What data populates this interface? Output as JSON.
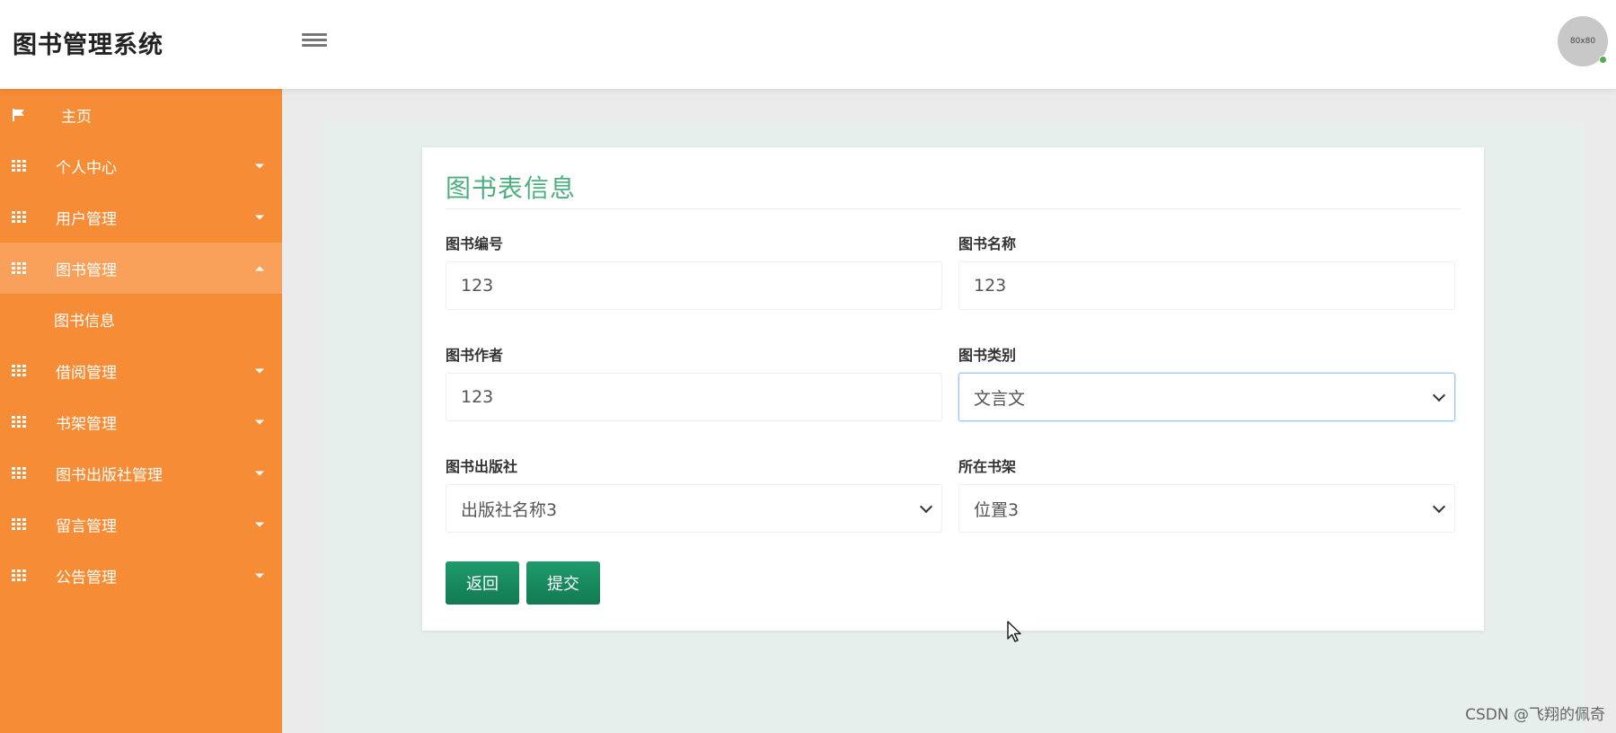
{
  "header": {
    "title": "图书管理系统",
    "avatar_text": "80x80"
  },
  "sidebar": {
    "items": [
      {
        "label": "主页",
        "icon": "flag-icon"
      },
      {
        "label": "个人中心",
        "icon": "grid-icon"
      },
      {
        "label": "用户管理",
        "icon": "grid-icon"
      },
      {
        "label": "图书管理",
        "icon": "grid-icon"
      },
      {
        "label": "借阅管理",
        "icon": "grid-icon"
      },
      {
        "label": "书架管理",
        "icon": "grid-icon"
      },
      {
        "label": "图书出版社管理",
        "icon": "grid-icon"
      },
      {
        "label": "留言管理",
        "icon": "grid-icon"
      },
      {
        "label": "公告管理",
        "icon": "grid-icon"
      }
    ],
    "sub_items": [
      {
        "label": "图书信息"
      }
    ]
  },
  "form": {
    "title": "图书表信息",
    "book_id": {
      "label": "图书编号",
      "value": "123"
    },
    "book_name": {
      "label": "图书名称",
      "value": "123"
    },
    "book_author": {
      "label": "图书作者",
      "value": "123"
    },
    "book_category": {
      "label": "图书类别",
      "value": "文言文"
    },
    "book_publisher": {
      "label": "图书出版社",
      "value": "出版社名称3"
    },
    "shelf": {
      "label": "所在书架",
      "value": "位置3"
    },
    "back_label": "返回",
    "submit_label": "提交"
  },
  "watermark": "CSDN @飞翔的佩奇",
  "colors": {
    "sidebar": "#f78c36",
    "accent_green": "#4caf7d",
    "button": "#1a8c60"
  }
}
